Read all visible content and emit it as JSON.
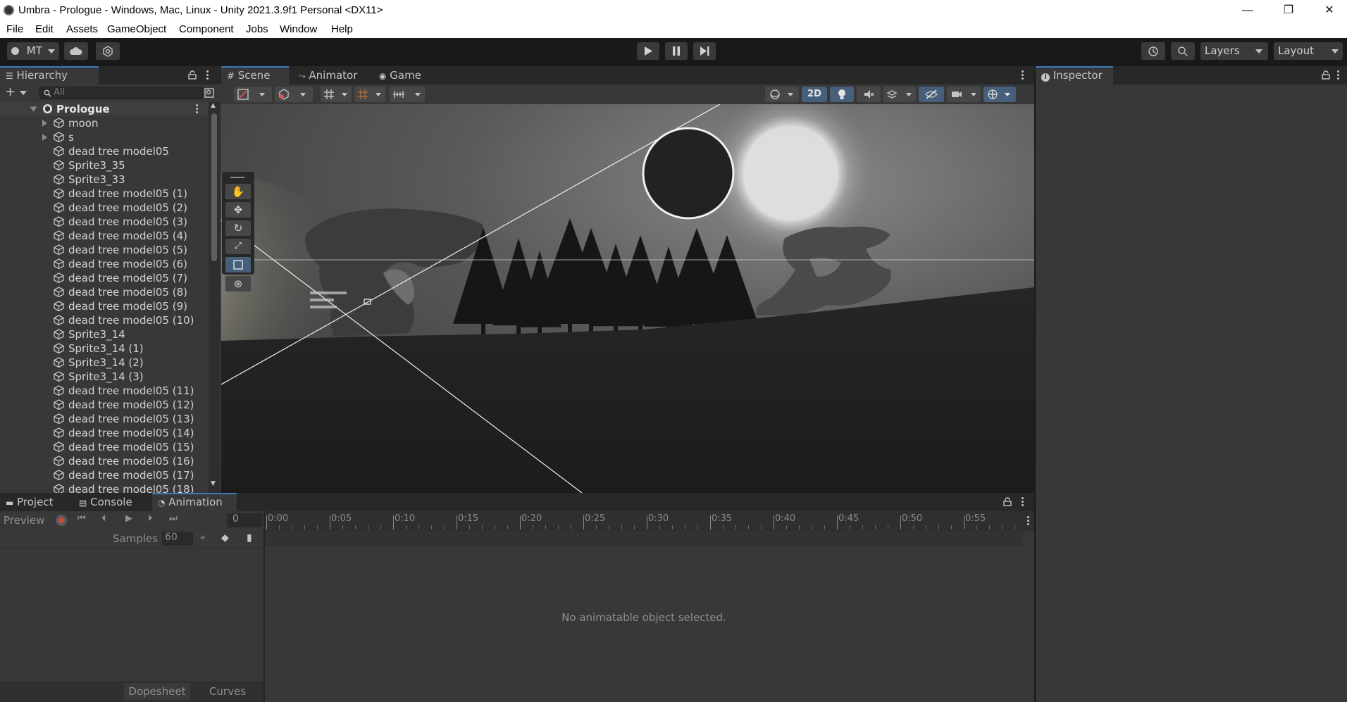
{
  "window": {
    "title": "Umbra - Prologue - Windows, Mac, Linux - Unity 2021.3.9f1 Personal <DX11>",
    "minimize": "—",
    "restore": "❐",
    "close": "✕"
  },
  "menu": [
    "File",
    "Edit",
    "Assets",
    "GameObject",
    "Component",
    "Jobs",
    "Window",
    "Help"
  ],
  "toolbar": {
    "account": "MT",
    "layers": "Layers",
    "layout": "Layout"
  },
  "hierarchy": {
    "tab": "Hierarchy",
    "search_placeholder": "All",
    "scene_root": "Prologue",
    "items": [
      {
        "name": "moon",
        "expandable": true
      },
      {
        "name": "s",
        "expandable": true
      },
      {
        "name": "dead tree model05"
      },
      {
        "name": "Sprite3_35"
      },
      {
        "name": "Sprite3_33"
      },
      {
        "name": "dead tree model05 (1)"
      },
      {
        "name": "dead tree model05 (2)"
      },
      {
        "name": "dead tree model05 (3)"
      },
      {
        "name": "dead tree model05 (4)"
      },
      {
        "name": "dead tree model05 (5)"
      },
      {
        "name": "dead tree model05 (6)"
      },
      {
        "name": "dead tree model05 (7)"
      },
      {
        "name": "dead tree model05 (8)"
      },
      {
        "name": "dead tree model05 (9)"
      },
      {
        "name": "dead tree model05 (10)"
      },
      {
        "name": "Sprite3_14"
      },
      {
        "name": "Sprite3_14 (1)"
      },
      {
        "name": "Sprite3_14 (2)"
      },
      {
        "name": "Sprite3_14 (3)"
      },
      {
        "name": "dead tree model05 (11)"
      },
      {
        "name": "dead tree model05 (12)"
      },
      {
        "name": "dead tree model05 (13)"
      },
      {
        "name": "dead tree model05 (14)"
      },
      {
        "name": "dead tree model05 (15)"
      },
      {
        "name": "dead tree model05 (16)"
      },
      {
        "name": "dead tree model05 (17)"
      },
      {
        "name": "dead tree model05 (18)"
      }
    ]
  },
  "scene": {
    "tabs": [
      "Scene",
      "Animator",
      "Game"
    ],
    "mode_2d": "2D"
  },
  "inspector": {
    "tab": "Inspector"
  },
  "bottom": {
    "tabs": [
      "Project",
      "Console",
      "Animation"
    ],
    "preview": "Preview",
    "frame": "0",
    "samples_label": "Samples",
    "samples_value": "60",
    "timeline_ticks": [
      "0:00",
      "0:05",
      "0:10",
      "0:15",
      "0:20",
      "0:25",
      "0:30",
      "0:35",
      "0:40",
      "0:45",
      "0:50",
      "0:55"
    ],
    "empty_message": "No animatable object selected.",
    "dopesheet": "Dopesheet",
    "curves": "Curves"
  }
}
